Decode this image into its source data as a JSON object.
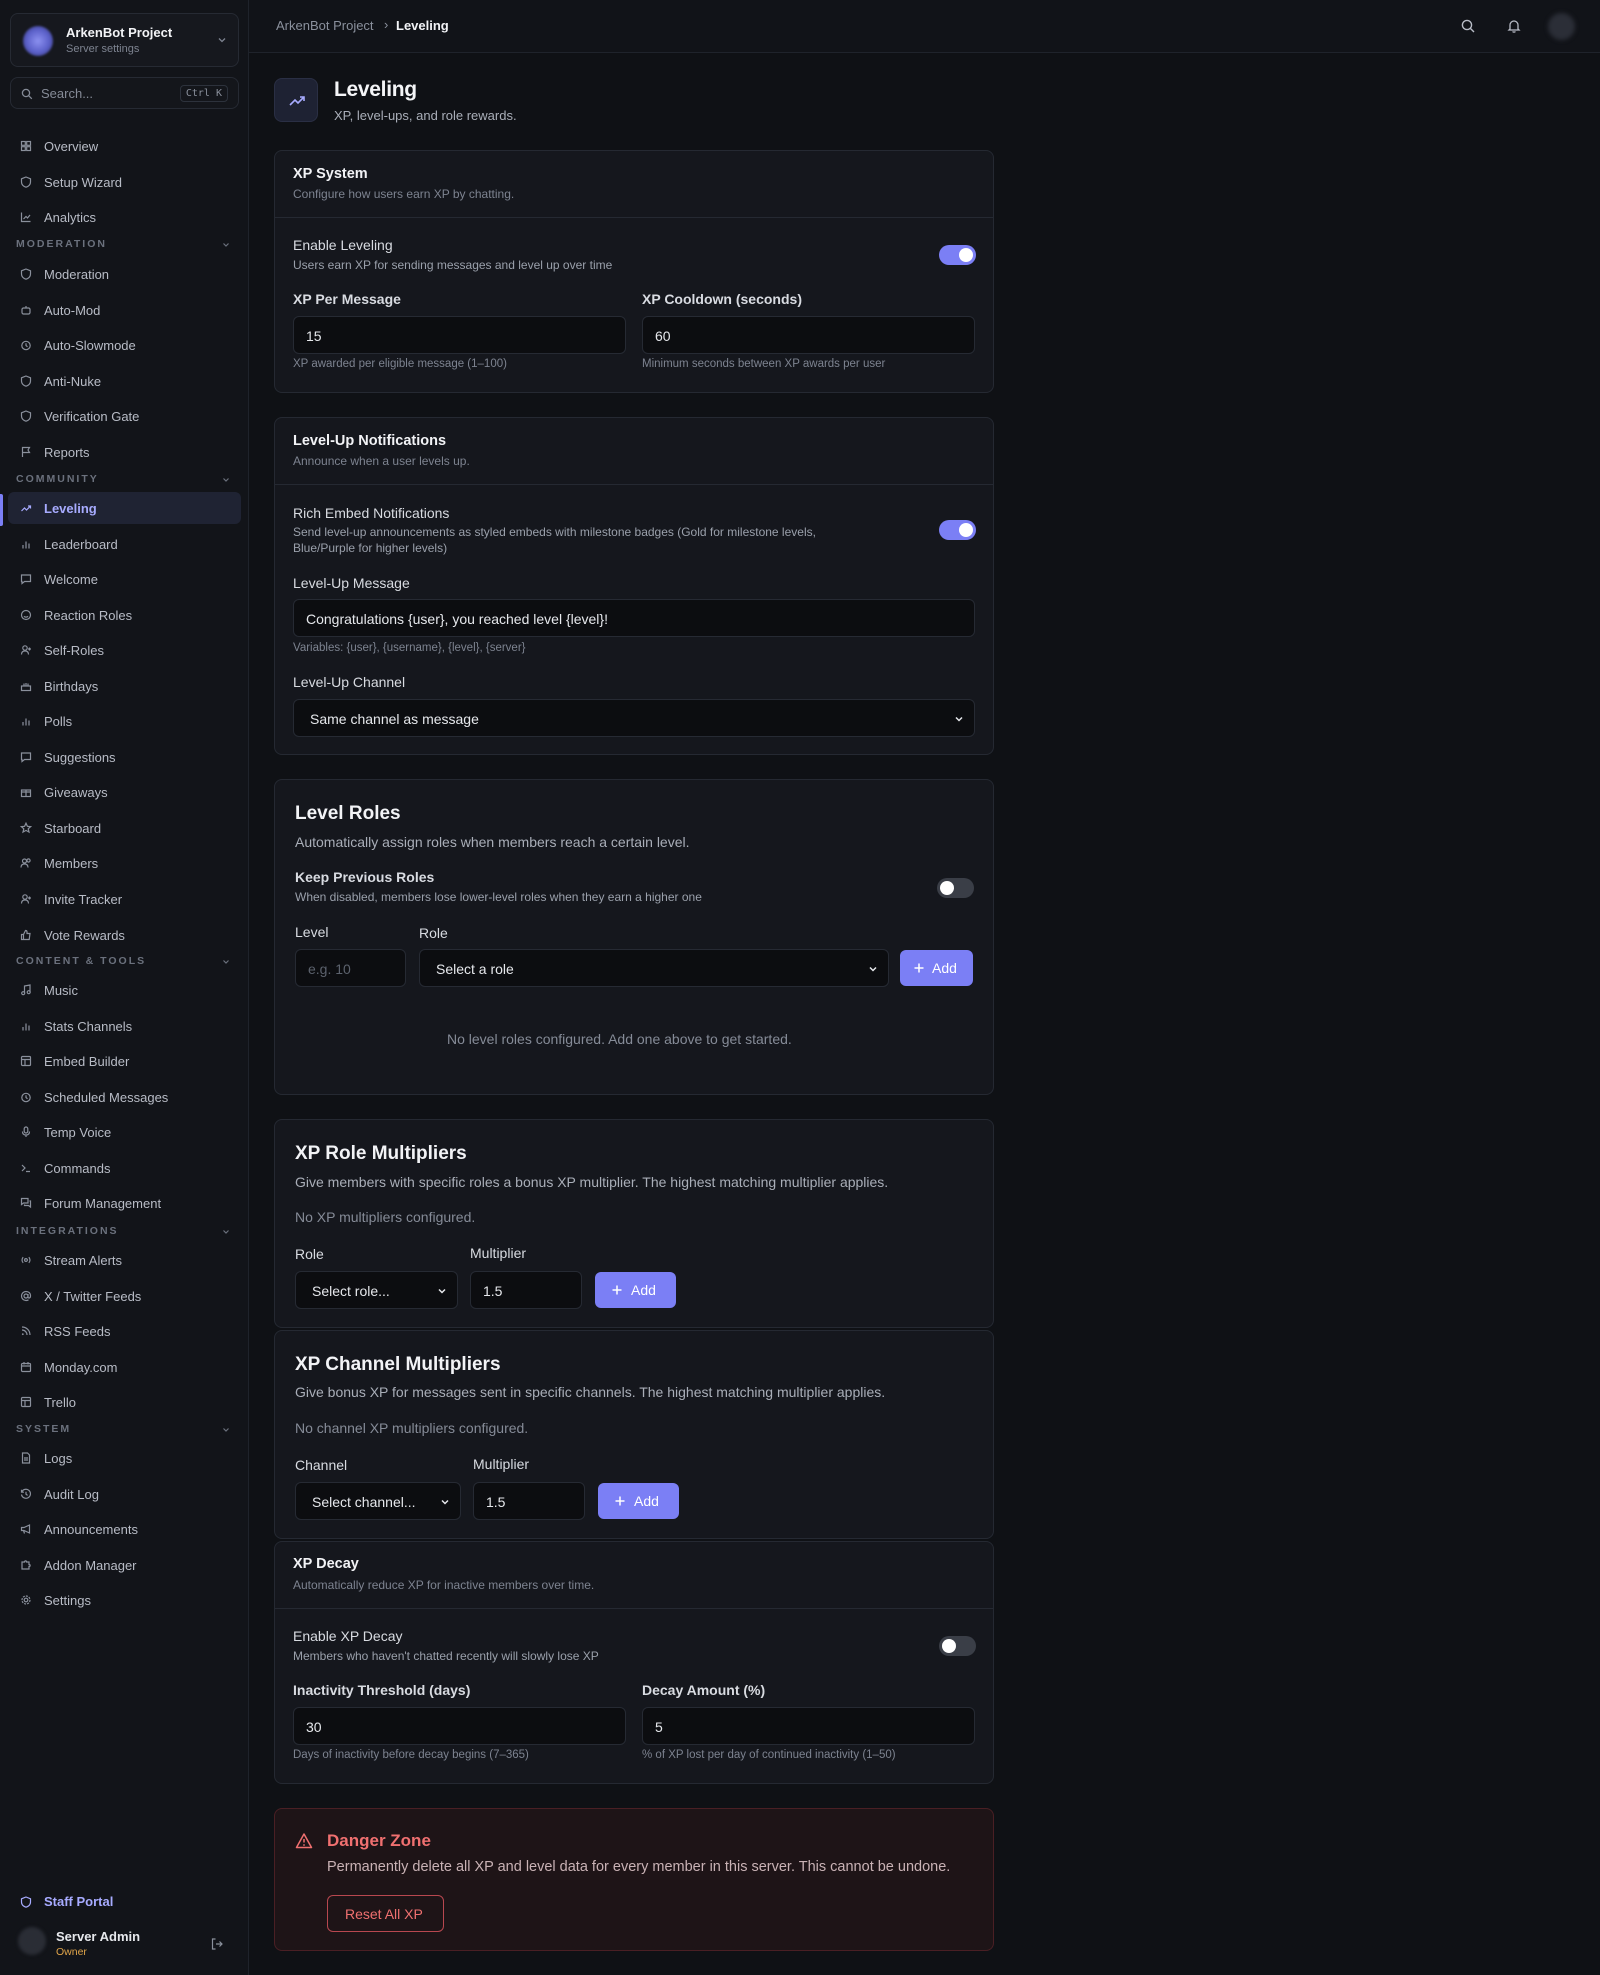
{
  "project": {
    "name": "ArkenBot Project",
    "subtitle": "Server settings"
  },
  "search": {
    "placeholder": "Search...",
    "shortcut": "Ctrl K"
  },
  "sidebar": {
    "top": [
      {
        "label": "Overview",
        "icon": "grid-icon"
      },
      {
        "label": "Setup Wizard",
        "icon": "shield-icon"
      },
      {
        "label": "Analytics",
        "icon": "line-chart-icon"
      }
    ],
    "sections": [
      {
        "title": "MODERATION",
        "items": [
          {
            "label": "Moderation",
            "icon": "shield-icon"
          },
          {
            "label": "Auto-Mod",
            "icon": "bot-icon"
          },
          {
            "label": "Auto-Slowmode",
            "icon": "timer-icon"
          },
          {
            "label": "Anti-Nuke",
            "icon": "shield-icon"
          },
          {
            "label": "Verification Gate",
            "icon": "shield-check-icon"
          },
          {
            "label": "Reports",
            "icon": "flag-icon"
          }
        ]
      },
      {
        "title": "COMMUNITY",
        "items": [
          {
            "label": "Leveling",
            "icon": "trending-up-icon",
            "active": true
          },
          {
            "label": "Leaderboard",
            "icon": "bar-chart-icon"
          },
          {
            "label": "Welcome",
            "icon": "message-icon"
          },
          {
            "label": "Reaction Roles",
            "icon": "smile-icon"
          },
          {
            "label": "Self-Roles",
            "icon": "user-check-icon"
          },
          {
            "label": "Birthdays",
            "icon": "cake-icon"
          },
          {
            "label": "Polls",
            "icon": "bar-chart-icon"
          },
          {
            "label": "Suggestions",
            "icon": "message-square-icon"
          },
          {
            "label": "Giveaways",
            "icon": "gift-icon"
          },
          {
            "label": "Starboard",
            "icon": "star-icon"
          },
          {
            "label": "Members",
            "icon": "users-icon"
          },
          {
            "label": "Invite Tracker",
            "icon": "user-plus-icon"
          },
          {
            "label": "Vote Rewards",
            "icon": "thumbs-up-icon"
          }
        ]
      },
      {
        "title": "CONTENT & TOOLS",
        "items": [
          {
            "label": "Music",
            "icon": "music-icon"
          },
          {
            "label": "Stats Channels",
            "icon": "bar-chart-icon"
          },
          {
            "label": "Embed Builder",
            "icon": "layout-icon"
          },
          {
            "label": "Scheduled Messages",
            "icon": "clock-icon"
          },
          {
            "label": "Temp Voice",
            "icon": "mic-icon"
          },
          {
            "label": "Commands",
            "icon": "terminal-icon"
          },
          {
            "label": "Forum Management",
            "icon": "messages-icon"
          }
        ]
      },
      {
        "title": "INTEGRATIONS",
        "items": [
          {
            "label": "Stream Alerts",
            "icon": "radio-icon"
          },
          {
            "label": "X / Twitter Feeds",
            "icon": "at-sign-icon"
          },
          {
            "label": "RSS Feeds",
            "icon": "rss-icon"
          },
          {
            "label": "Monday.com",
            "icon": "calendar-icon"
          },
          {
            "label": "Trello",
            "icon": "trello-icon"
          }
        ]
      },
      {
        "title": "SYSTEM",
        "items": [
          {
            "label": "Logs",
            "icon": "file-text-icon"
          },
          {
            "label": "Audit Log",
            "icon": "history-icon"
          },
          {
            "label": "Announcements",
            "icon": "megaphone-icon"
          },
          {
            "label": "Addon Manager",
            "icon": "puzzle-icon"
          },
          {
            "label": "Settings",
            "icon": "gear-icon"
          }
        ]
      }
    ],
    "staff_portal": "Staff Portal",
    "user": {
      "name": "Server Admin",
      "role": "Owner"
    }
  },
  "breadcrumb": {
    "parent": "ArkenBot Project",
    "sep": "›",
    "current": "Leveling"
  },
  "page": {
    "title": "Leveling",
    "subtitle": "XP, level-ups, and role rewards."
  },
  "xp_system": {
    "title": "XP System",
    "subtitle": "Configure how users earn XP by chatting.",
    "enable_label": "Enable Leveling",
    "enable_desc": "Users earn XP for sending messages and level up over time",
    "enabled": true,
    "per_message_label": "XP Per Message",
    "per_message_value": "15",
    "per_message_hint": "XP awarded per eligible message (1–100)",
    "cooldown_label": "XP Cooldown (seconds)",
    "cooldown_value": "60",
    "cooldown_hint": "Minimum seconds between XP awards per user"
  },
  "levelup": {
    "title": "Level-Up Notifications",
    "subtitle": "Announce when a user levels up.",
    "rich_label": "Rich Embed Notifications",
    "rich_desc1": "Send level-up announcements as styled embeds with milestone badges (Gold for milestone levels,",
    "rich_desc2": "Blue/Purple for higher levels)",
    "rich_enabled": true,
    "message_label": "Level-Up Message",
    "message_value": "Congratulations {user}, you reached level {level}!",
    "variables_hint": "Variables: {user}, {username}, {level}, {server}",
    "channel_label": "Level-Up Channel",
    "channel_value": "Same channel as message"
  },
  "level_roles": {
    "title": "Level Roles",
    "subtitle": "Automatically assign roles when members reach a certain level.",
    "keep_label": "Keep Previous Roles",
    "keep_desc": "When disabled, members lose lower-level roles when they earn a higher one",
    "keep_enabled": false,
    "level_label": "Level",
    "level_placeholder": "e.g. 10",
    "role_label": "Role",
    "role_value": "Select a role",
    "add_label": "Add",
    "empty": "No level roles configured. Add one above to get started."
  },
  "role_multipliers": {
    "title": "XP Role Multipliers",
    "subtitle": "Give members with specific roles a bonus XP multiplier. The highest matching multiplier applies.",
    "empty": "No XP multipliers configured.",
    "role_label": "Role",
    "role_value": "Select role...",
    "multiplier_label": "Multiplier",
    "multiplier_value": "1.5",
    "add_label": "Add"
  },
  "channel_multipliers": {
    "title": "XP Channel Multipliers",
    "subtitle": "Give bonus XP for messages sent in specific channels. The highest matching multiplier applies.",
    "empty": "No channel XP multipliers configured.",
    "channel_label": "Channel",
    "channel_value": "Select channel...",
    "multiplier_label": "Multiplier",
    "multiplier_value": "1.5",
    "add_label": "Add"
  },
  "decay": {
    "title": "XP Decay",
    "subtitle": "Automatically reduce XP for inactive members over time.",
    "enable_label": "Enable XP Decay",
    "enable_desc": "Members who haven't chatted recently will slowly lose XP",
    "enabled": false,
    "threshold_label": "Inactivity Threshold (days)",
    "threshold_value": "30",
    "threshold_hint": "Days of inactivity before decay begins (7–365)",
    "amount_label": "Decay Amount (%)",
    "amount_value": "5",
    "amount_hint": "% of XP lost per day of continued inactivity (1–50)"
  },
  "danger": {
    "title": "Danger Zone",
    "subtitle": "Permanently delete all XP and level data for every member in this server. This cannot be undone.",
    "button": "Reset All XP"
  },
  "colors": {
    "accent": "#7b7ff5",
    "danger": "#f07070",
    "owner": "#e0a54a"
  }
}
